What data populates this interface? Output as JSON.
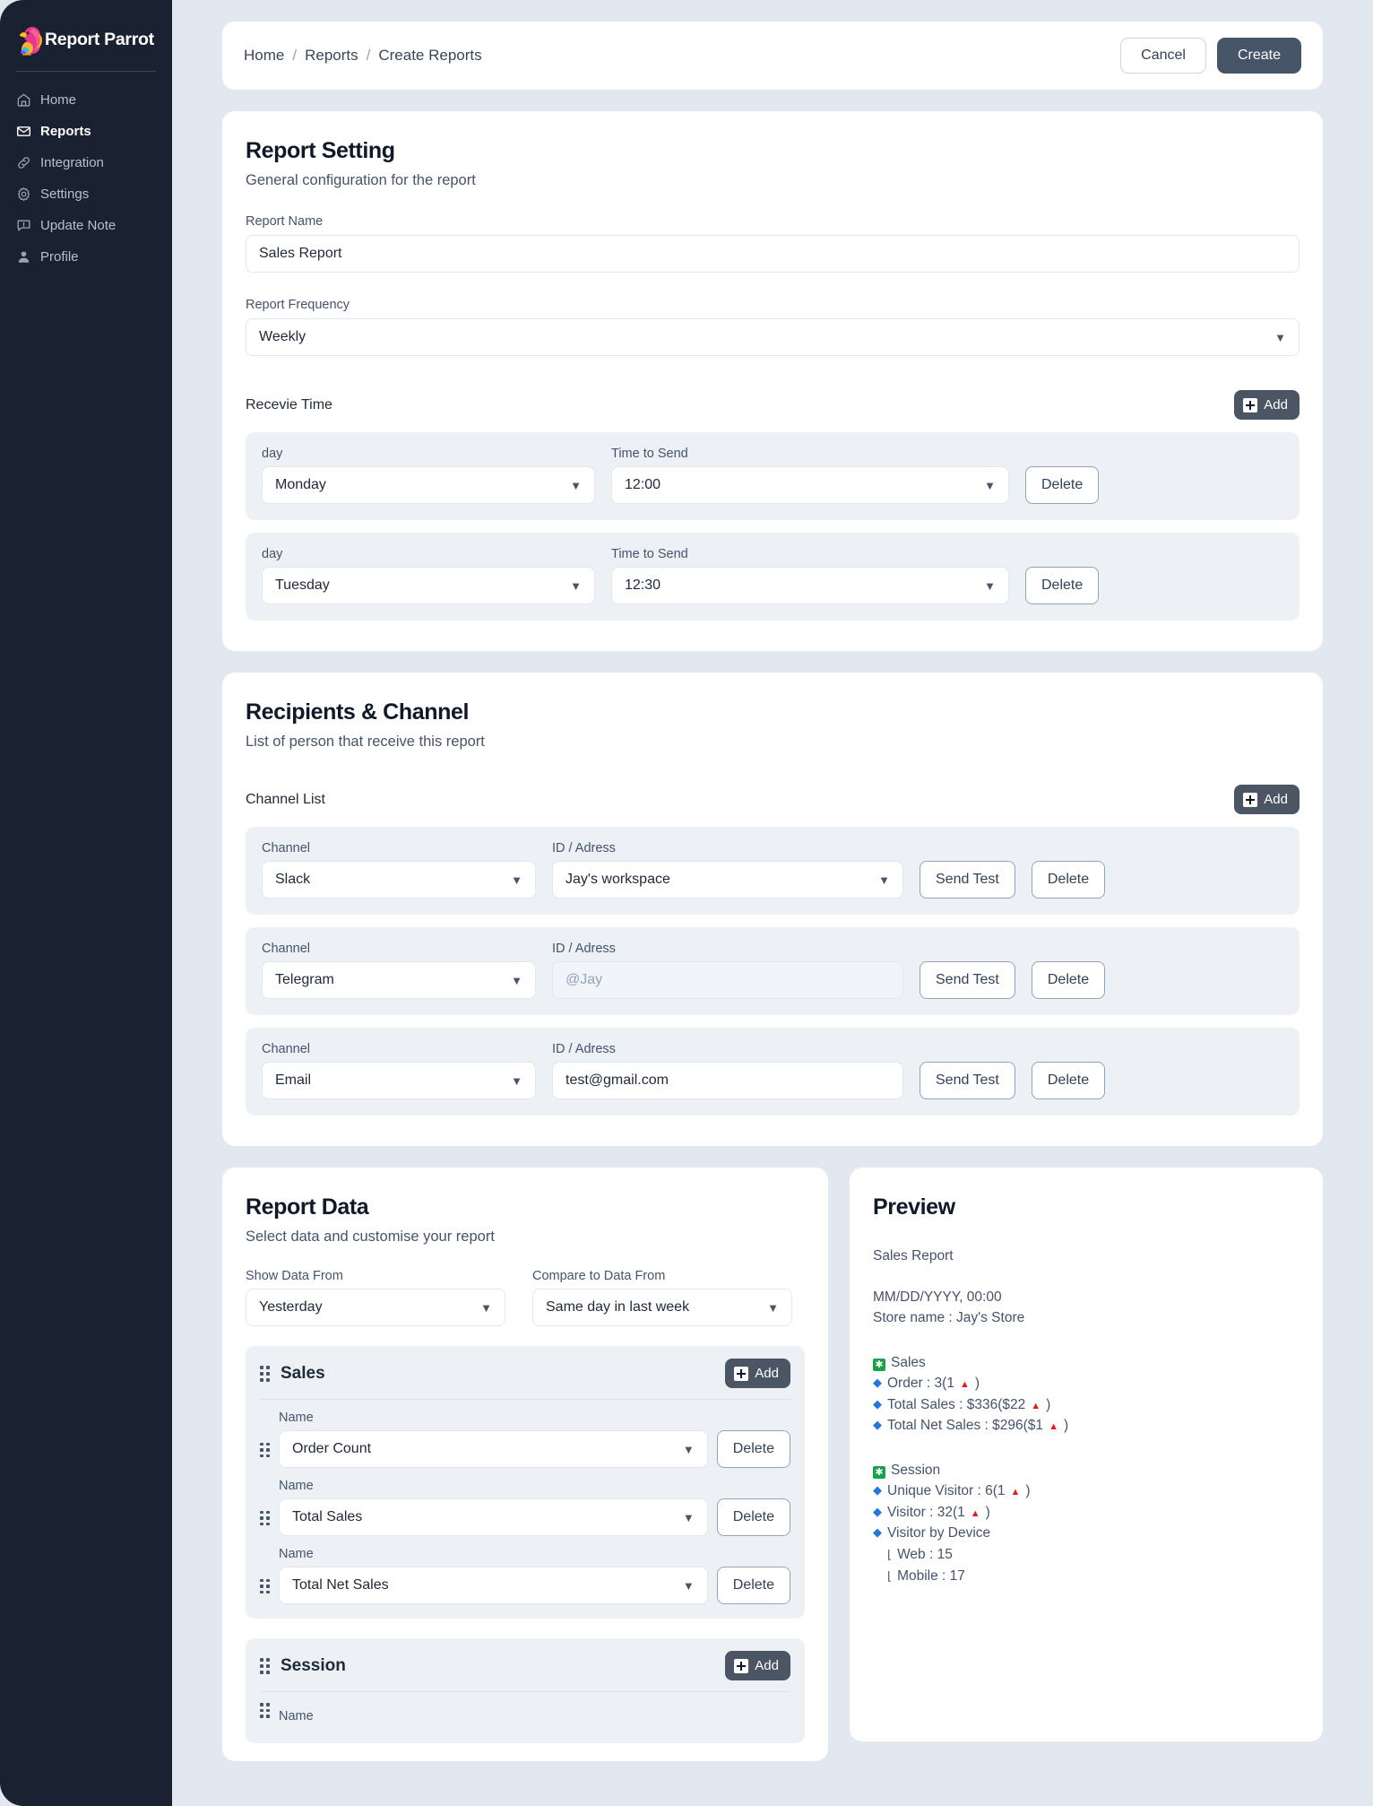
{
  "brand": {
    "name": "Report Parrot",
    "logo_icon": "parrot-logo-icon"
  },
  "sidebar": {
    "items": [
      {
        "label": "Home",
        "icon": "home-icon",
        "active": false
      },
      {
        "label": "Reports",
        "icon": "envelope-icon",
        "active": true
      },
      {
        "label": "Integration",
        "icon": "link-icon",
        "active": false
      },
      {
        "label": "Settings",
        "icon": "gear-icon",
        "active": false
      },
      {
        "label": "Update Note",
        "icon": "message-icon",
        "active": false
      },
      {
        "label": "Profile",
        "icon": "person-icon",
        "active": false
      }
    ]
  },
  "topbar": {
    "breadcrumb": [
      "Home",
      "Reports",
      "Create Reports"
    ],
    "separator": "/",
    "cancel_label": "Cancel",
    "create_label": "Create"
  },
  "report_setting": {
    "title": "Report Setting",
    "subtitle": "General configuration for the report",
    "report_name_label": "Report Name",
    "report_name_value": "Sales Report",
    "frequency_label": "Report Frequency",
    "frequency_value": "Weekly",
    "receive_time_label": "Recevie Time",
    "add_label": "Add",
    "day_label": "day",
    "time_label": "Time to Send",
    "delete_label": "Delete",
    "rows": [
      {
        "day": "Monday",
        "time": "12:00"
      },
      {
        "day": "Tuesday",
        "time": "12:30"
      }
    ]
  },
  "recipients": {
    "title": "Recipients & Channel",
    "subtitle": "List of person that receive this report",
    "channel_list_label": "Channel List",
    "add_label": "Add",
    "channel_label": "Channel",
    "address_label": "ID / Adress",
    "send_test_label": "Send Test",
    "delete_label": "Delete",
    "rows": [
      {
        "channel": "Slack",
        "address": "Jay's workspace",
        "address_is_select": true,
        "address_is_placeholder": false
      },
      {
        "channel": "Telegram",
        "address": "@Jay",
        "address_is_select": false,
        "address_is_placeholder": true
      },
      {
        "channel": "Email",
        "address": "test@gmail.com",
        "address_is_select": false,
        "address_is_placeholder": false
      }
    ]
  },
  "report_data": {
    "title": "Report Data",
    "subtitle": "Select data and customise your report",
    "show_from_label": "Show Data From",
    "show_from_value": "Yesterday",
    "compare_label": "Compare to Data From",
    "compare_value": "Same day in last week",
    "name_label": "Name",
    "add_label": "Add",
    "delete_label": "Delete",
    "groups": [
      {
        "title": "Sales",
        "items": [
          "Order Count",
          "Total Sales",
          "Total Net Sales"
        ]
      },
      {
        "title": "Session",
        "items": []
      }
    ]
  },
  "preview": {
    "title": "Preview",
    "report_name": "Sales Report",
    "timestamp": "MM/DD/YYYY, 00:00",
    "store_line": "Store name : Jay's Store",
    "sections": [
      {
        "heading": "Sales",
        "metrics": [
          {
            "text": "Order : 3(1",
            "suffix": ")"
          },
          {
            "text": "Total Sales : $336($22",
            "suffix": ")"
          },
          {
            "text": "Total Net Sales : $296($1",
            "suffix": ")"
          }
        ],
        "subitems": []
      },
      {
        "heading": "Session",
        "metrics": [
          {
            "text": "Unique Visitor : 6(1",
            "suffix": ")"
          },
          {
            "text": "Visitor : 32(1",
            "suffix": ")"
          }
        ],
        "plain_metrics": [
          "Visitor by Device"
        ],
        "subitems": [
          "Web : 15",
          "Mobile : 17"
        ]
      }
    ]
  },
  "colors": {
    "sidebar_bg": "#1a2131",
    "page_bg": "#e2e8f0",
    "primary_button": "#475569",
    "accent_add": "#4b5563",
    "up_arrow": "#e11d1d",
    "bullet": "#2277dd",
    "section_icon": "#16a34a"
  }
}
